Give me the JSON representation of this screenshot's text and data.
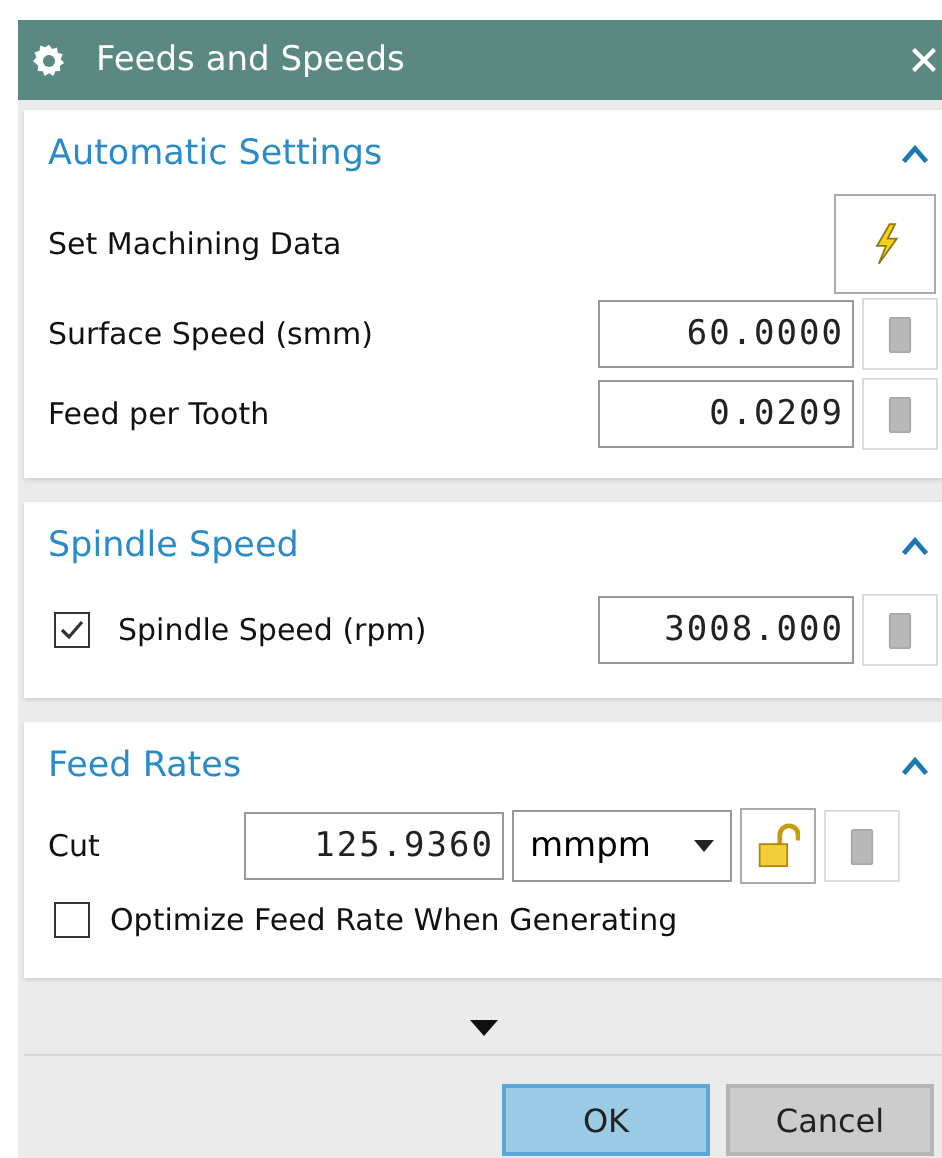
{
  "window": {
    "title": "Feeds and Speeds"
  },
  "sections": [
    {
      "title": "Automatic Settings",
      "expanded": true,
      "rows": [
        {
          "kind": "action",
          "label": "Set Machining Data"
        },
        {
          "kind": "value",
          "label": "Surface Speed (smm)",
          "value": "60.0000"
        },
        {
          "kind": "value",
          "label": "Feed per Tooth",
          "value": "0.0209"
        }
      ]
    },
    {
      "title": "Spindle Speed",
      "expanded": true,
      "rows": [
        {
          "kind": "check-value",
          "label": "Spindle Speed (rpm)",
          "checked": true,
          "value": "3008.000"
        }
      ]
    },
    {
      "title": "Feed Rates",
      "expanded": true,
      "rows": [
        {
          "kind": "unit-value",
          "label": "Cut",
          "value": "125.9360",
          "unit": "mmpm",
          "locked": false
        },
        {
          "kind": "check",
          "label": "Optimize Feed Rate When Generating",
          "checked": false
        }
      ]
    }
  ],
  "buttons": [
    {
      "label": "OK",
      "default": true
    },
    {
      "label": "Cancel",
      "default": false
    }
  ]
}
